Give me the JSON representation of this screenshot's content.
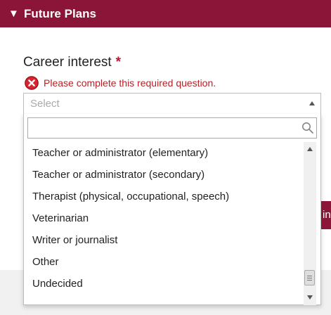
{
  "section": {
    "toggle_glyph": "▼",
    "title": "Future Plans"
  },
  "question": {
    "label": "Career interest",
    "required_marker": "*",
    "error_message": "Please complete this required question."
  },
  "select": {
    "placeholder": "Select",
    "search_value": "",
    "options": [
      "Teacher or administrator (elementary)",
      "Teacher or administrator (secondary)",
      "Therapist (physical, occupational, speech)",
      "Veterinarian",
      "Writer or journalist",
      "Other",
      "Undecided"
    ]
  },
  "next_button": {
    "visible_label": "in"
  },
  "colors": {
    "brand": "#8a1538",
    "error": "#b81f24"
  },
  "icons": {
    "error": "error-x-circle-icon",
    "search": "search-icon",
    "toggle": "triangle-down-icon"
  }
}
